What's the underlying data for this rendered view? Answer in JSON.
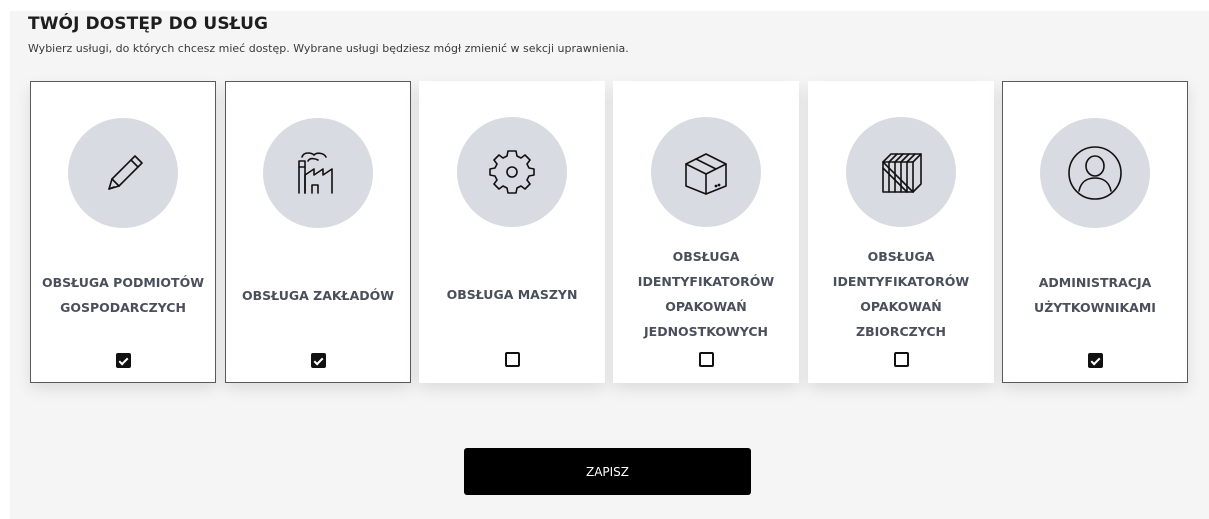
{
  "header": {
    "title": "TWÓJ DOSTĘP DO USŁUG",
    "subtitle": "Wybierz usługi, do których chcesz mieć dostęp. Wybrane usługi będziesz mógł zmienić w sekcji uprawnienia."
  },
  "services": [
    {
      "label": "OBSŁUGA PODMIOTÓW GOSPODARCZYCH",
      "icon": "pencil-icon",
      "checked": true
    },
    {
      "label": "OBSŁUGA ZAKŁADÓW",
      "icon": "factory-icon",
      "checked": true
    },
    {
      "label": "OBSŁUGA MASZYN",
      "icon": "gear-icon",
      "checked": false
    },
    {
      "label": "OBSŁUGA IDENTYFIKATORÓW OPAKOWAŃ JEDNOSTKOWYCH",
      "icon": "box-icon",
      "checked": false
    },
    {
      "label": "OBSŁUGA IDENTYFIKATORÓW OPAKOWAŃ ZBIORCZYCH",
      "icon": "crate-icon",
      "checked": false
    },
    {
      "label": "ADMINISTRACJA UŻYTKOWNIKAMI",
      "icon": "user-icon",
      "checked": true
    }
  ],
  "actions": {
    "save_label": "ZAPISZ"
  },
  "colors": {
    "panel_background": "#f5f5f5",
    "icon_circle": "#d8dbe1",
    "label_text": "#4a4f5b",
    "button_background": "#000000"
  }
}
